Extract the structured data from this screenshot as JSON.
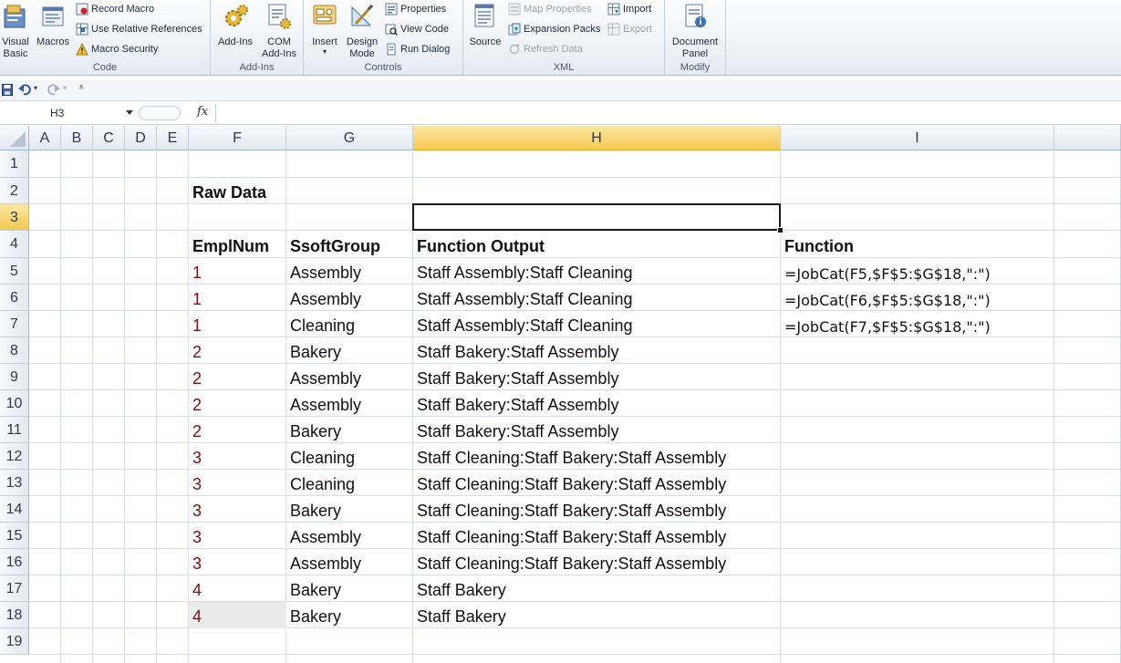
{
  "ribbon": {
    "groups": {
      "code": {
        "label": "Code",
        "visual_basic": "Visual\nBasic",
        "macros": "Macros",
        "record_macro": "Record Macro",
        "use_relative": "Use Relative References",
        "macro_security": "Macro Security"
      },
      "addins": {
        "label": "Add-Ins",
        "addins_btn": "Add-Ins",
        "com_addins": "COM\nAdd-Ins"
      },
      "controls": {
        "label": "Controls",
        "insert": "Insert",
        "design_mode": "Design\nMode",
        "properties": "Properties",
        "view_code": "View Code",
        "run_dialog": "Run Dialog"
      },
      "xml": {
        "label": "XML",
        "source": "Source",
        "map_properties": "Map Properties",
        "expansion_packs": "Expansion Packs",
        "refresh_data": "Refresh Data",
        "import": "Import",
        "export": "Export"
      },
      "modify": {
        "label": "Modify",
        "document_panel": "Document\nPanel"
      }
    }
  },
  "formula_bar": {
    "name_box": "H3",
    "fx": "fx",
    "formula": ""
  },
  "columns": [
    "A",
    "B",
    "C",
    "D",
    "E",
    "F",
    "G",
    "H",
    "I"
  ],
  "selected_column": "H",
  "selected_row": 3,
  "rows": [
    "1",
    "2",
    "3",
    "4",
    "5",
    "6",
    "7",
    "8",
    "9",
    "10",
    "11",
    "12",
    "13",
    "14",
    "15",
    "16",
    "17",
    "18",
    "19"
  ],
  "sheet": {
    "title": "Raw Data",
    "headers": {
      "f": "EmplNum",
      "g": "SsoftGroup",
      "h": "Function Output",
      "i": "Function"
    },
    "data": [
      {
        "row": 5,
        "empl": "1",
        "group": "Assembly",
        "output": "Staff Assembly:Staff Cleaning",
        "func": "=JobCat(F5,$F$5:$G$18,\":\")"
      },
      {
        "row": 6,
        "empl": "1",
        "group": "Assembly",
        "output": "Staff Assembly:Staff Cleaning",
        "func": "=JobCat(F6,$F$5:$G$18,\":\")"
      },
      {
        "row": 7,
        "empl": "1",
        "group": "Cleaning",
        "output": "Staff Assembly:Staff Cleaning",
        "func": "=JobCat(F7,$F$5:$G$18,\":\")"
      },
      {
        "row": 8,
        "empl": "2",
        "group": "Bakery",
        "output": "Staff Bakery:Staff Assembly",
        "func": ""
      },
      {
        "row": 9,
        "empl": "2",
        "group": "Assembly",
        "output": "Staff Bakery:Staff Assembly",
        "func": ""
      },
      {
        "row": 10,
        "empl": "2",
        "group": "Assembly",
        "output": "Staff Bakery:Staff Assembly",
        "func": ""
      },
      {
        "row": 11,
        "empl": "2",
        "group": "Bakery",
        "output": "Staff Bakery:Staff Assembly",
        "func": ""
      },
      {
        "row": 12,
        "empl": "3",
        "group": "Cleaning",
        "output": "Staff Cleaning:Staff Bakery:Staff Assembly",
        "func": ""
      },
      {
        "row": 13,
        "empl": "3",
        "group": "Cleaning",
        "output": "Staff Cleaning:Staff Bakery:Staff Assembly",
        "func": ""
      },
      {
        "row": 14,
        "empl": "3",
        "group": "Bakery",
        "output": "Staff Cleaning:Staff Bakery:Staff Assembly",
        "func": ""
      },
      {
        "row": 15,
        "empl": "3",
        "group": "Assembly",
        "output": "Staff Cleaning:Staff Bakery:Staff Assembly",
        "func": ""
      },
      {
        "row": 16,
        "empl": "3",
        "group": "Assembly",
        "output": "Staff Cleaning:Staff Bakery:Staff Assembly",
        "func": ""
      },
      {
        "row": 17,
        "empl": "4",
        "group": "Bakery",
        "output": "Staff Bakery",
        "func": ""
      },
      {
        "row": 18,
        "empl": "4",
        "group": "Bakery",
        "output": "Staff Bakery",
        "func": ""
      }
    ]
  },
  "colors": {
    "number_text": "#7a1010",
    "selected_header": "#f5c94f",
    "grid_line": "#d8dde5"
  }
}
